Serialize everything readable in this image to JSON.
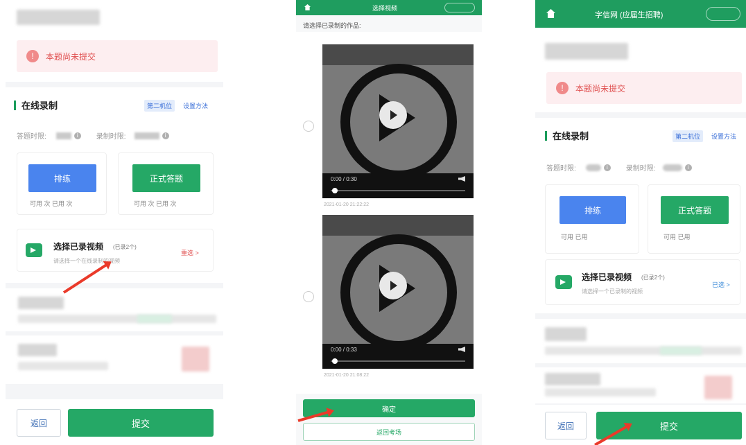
{
  "screen1": {
    "alert_text": "本题尚未提交",
    "section_title": "在线录制",
    "badge_text": "第二机位",
    "settings_link": "设置方法",
    "meta_answer_label": "答题时限:",
    "meta_record_label": "录制时限:",
    "practice_label": "排练",
    "formal_label": "正式答题",
    "practice_sub": "可用 次 已用 次",
    "formal_sub": "可用 次 已用 次",
    "select_title": "选择已录视频",
    "select_count": "(已录2个)",
    "select_sub": "请选择一个在线录制的视频",
    "select_action": "重选 >",
    "back_label": "返回",
    "submit_label": "提交"
  },
  "screen2": {
    "top_title": "选择视频",
    "hint": "请选择已录制的作品:",
    "video1_time": "0:00 / 0:30",
    "video1_date": "2021-01-20 21:22:22",
    "video2_time": "0:00 / 0:33",
    "video2_date": "2021-01-20 21:08:22",
    "confirm_label": "确定",
    "back_label": "返回考场"
  },
  "screen3": {
    "top_title": "字信网 (应届生招聘)",
    "alert_text": "本题尚未提交",
    "section_title": "在线录制",
    "badge_text": "第二机位",
    "settings_link": "设置方法",
    "meta_answer_label": "答题时限:",
    "meta_record_label": "录制时限:",
    "practice_label": "排练",
    "formal_label": "正式答题",
    "practice_sub": "可用 已用",
    "formal_sub": "可用 已用",
    "select_title": "选择已录视频",
    "select_count": "(已录2个)",
    "select_sub": "请选择一个已录制的视频",
    "select_action": "已选 >",
    "back_label": "返回",
    "submit_label": "提交"
  },
  "colors": {
    "primary_green": "#25a866",
    "header_green": "#1f9d5f",
    "accent_blue": "#4a84ee",
    "alert_red": "#e05050",
    "arrow_red": "#ea3a2a"
  }
}
